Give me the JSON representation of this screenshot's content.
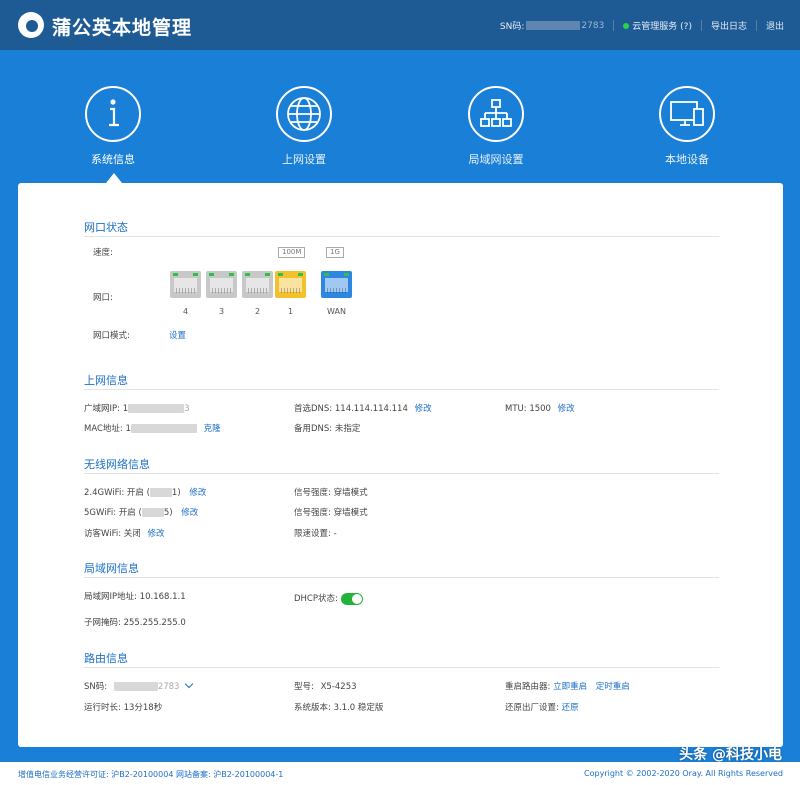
{
  "header": {
    "brand": "蒲公英本地管理",
    "sn_label": "SN码:",
    "sn_value_tail": "2783",
    "cloud_service": "云管理服务 (?)",
    "export_log": "导出日志",
    "logout": "退出"
  },
  "nav": {
    "items": [
      {
        "label": "系统信息",
        "icon": "info-icon"
      },
      {
        "label": "上网设置",
        "icon": "globe-icon"
      },
      {
        "label": "局域网设置",
        "icon": "network-tree-icon"
      },
      {
        "label": "本地设备",
        "icon": "devices-icon"
      }
    ],
    "active": 0
  },
  "port_status": {
    "title": "网口状态",
    "speed_label": "速度:",
    "speed_100": "100M",
    "speed_1g": "1G",
    "port_label": "网口:",
    "ports": [
      {
        "label": "4",
        "color": "#c8c8c8"
      },
      {
        "label": "3",
        "color": "#c8c8c8"
      },
      {
        "label": "2",
        "color": "#c8c8c8"
      },
      {
        "label": "1",
        "color": "#f3c12e"
      },
      {
        "label": "WAN",
        "color": "#2c86e2"
      }
    ],
    "mode_label": "网口模式:",
    "mode_link": "设置"
  },
  "internet_info": {
    "title": "上网信息",
    "wan_ip_label": "广域网IP:",
    "wan_ip_head": "1",
    "wan_ip_tail": "3",
    "primary_dns_label": "首选DNS:",
    "primary_dns": "114.114.114.114",
    "edit": "修改",
    "mtu_label": "MTU:",
    "mtu": "1500",
    "mac_label": "MAC地址:",
    "mac_head": "1",
    "clone": "克隆",
    "backup_dns_label": "备用DNS:",
    "backup_dns": "未指定"
  },
  "wifi_info": {
    "title": "无线网络信息",
    "wifi24_label": "2.4GWiFi:",
    "wifi24_state": "开启 (",
    "wifi24_tail": "1)",
    "wifi5_label": "5GWiFi:",
    "wifi5_state": "开启 (",
    "wifi5_tail": "5)",
    "guest_label": "访客WiFi:",
    "guest_state": "关闭",
    "edit": "修改",
    "signal_label": "信号强度:",
    "signal_value": "穿墙模式",
    "speed_limit_label": "限速设置:",
    "speed_limit_value": "-"
  },
  "lan_info": {
    "title": "局域网信息",
    "lan_ip_label": "局域网IP地址:",
    "lan_ip": "10.168.1.1",
    "dhcp_label": "DHCP状态:",
    "dhcp_on": true,
    "subnet_label": "子网掩码:",
    "subnet": "255.255.255.0"
  },
  "router_info": {
    "title": "路由信息",
    "sn_label": "SN码:",
    "sn_tail": "2783",
    "model_label": "型号:",
    "model": "X5-4253",
    "reboot_label": "重启路由器:",
    "reboot_now": "立即重启",
    "reboot_timed": "定时重启",
    "uptime_label": "运行时长:",
    "uptime": "13分18秒",
    "version_label": "系统版本:",
    "version": "3.1.0 稳定版",
    "factory_label": "还原出厂设置:",
    "factory_link": "还原"
  },
  "footer": {
    "license": "增值电信业务经营许可证: 沪B2-20100004 网站备案: 沪B2-20100004-1",
    "copyright": "Copyright © 2002-2020 Oray. All Rights Reserved"
  },
  "watermark": "头条 @科技小电"
}
